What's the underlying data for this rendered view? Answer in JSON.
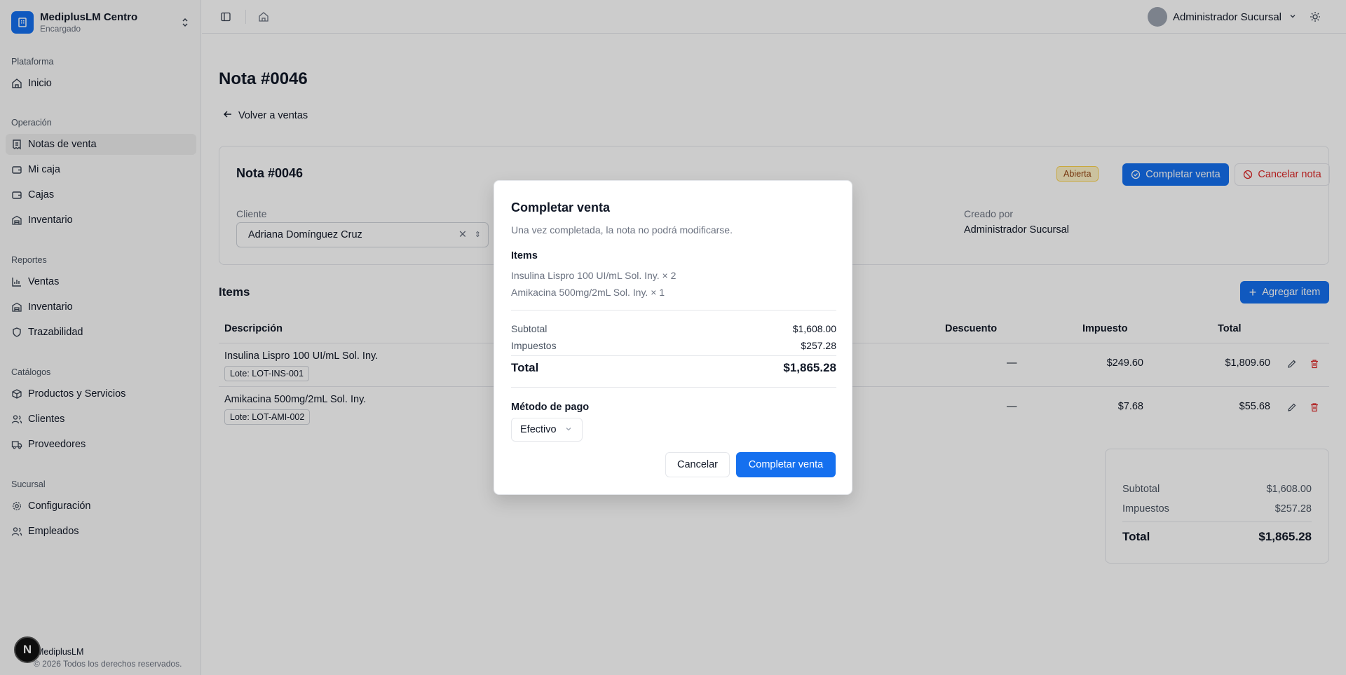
{
  "colors": {
    "primary": "#1570ef",
    "danger": "#dc2626",
    "badge_open_bg": "#fef3c7"
  },
  "sidebar": {
    "brand_name": "MediplusLM Centro",
    "brand_role": "Encargado",
    "sections": [
      {
        "title": "Plataforma",
        "items": [
          {
            "label": "Inicio",
            "icon": "home-icon"
          }
        ]
      },
      {
        "title": "Operación",
        "items": [
          {
            "label": "Notas de venta",
            "icon": "receipt-icon",
            "active": true
          },
          {
            "label": "Mi caja",
            "icon": "wallet-icon"
          },
          {
            "label": "Cajas",
            "icon": "wallet-icon"
          },
          {
            "label": "Inventario",
            "icon": "warehouse-icon"
          }
        ]
      },
      {
        "title": "Reportes",
        "items": [
          {
            "label": "Ventas",
            "icon": "bar-chart-icon"
          },
          {
            "label": "Inventario",
            "icon": "warehouse-icon"
          },
          {
            "label": "Trazabilidad",
            "icon": "shield-icon"
          }
        ]
      },
      {
        "title": "Catálogos",
        "items": [
          {
            "label": "Productos y Servicios",
            "icon": "package-icon"
          },
          {
            "label": "Clientes",
            "icon": "users-icon"
          },
          {
            "label": "Proveedores",
            "icon": "truck-icon"
          }
        ]
      },
      {
        "title": "Sucursal",
        "items": [
          {
            "label": "Configuración",
            "icon": "gear-icon"
          },
          {
            "label": "Empleados",
            "icon": "users-icon"
          }
        ]
      }
    ],
    "footer_badge": "N",
    "footer_name": "MediplusLM",
    "footer_copy": "© 2026 Todos los derechos reservados."
  },
  "topbar": {
    "user_name": "Administrador Sucursal"
  },
  "page": {
    "title": "Nota #0046",
    "back_label": "Volver a ventas",
    "card": {
      "title": "Nota #0046",
      "status": "Abierta",
      "complete_label": "Completar venta",
      "cancel_label": "Cancelar nota",
      "client_label": "Cliente",
      "client_value": "Adriana Domínguez Cruz",
      "creator_label": "Creado por",
      "creator_value": "Administrador Sucursal"
    },
    "items_title": "Items",
    "add_item_label": "Agregar item",
    "columns": {
      "description": "Descripción",
      "discount": "Descuento",
      "tax": "Impuesto",
      "total": "Total"
    },
    "rows": [
      {
        "description": "Insulina Lispro 100 UI/mL Sol. Iny.",
        "lot": "Lote: LOT-INS-001",
        "discount": "—",
        "tax": "$249.60",
        "total": "$1,809.60"
      },
      {
        "description": "Amikacina 500mg/2mL Sol. Iny.",
        "lot": "Lote: LOT-AMI-002",
        "discount": "—",
        "tax": "$7.68",
        "total": "$55.68"
      }
    ],
    "summary": {
      "subtotal_label": "Subtotal",
      "subtotal": "$1,608.00",
      "tax_label": "Impuestos",
      "tax": "$257.28",
      "total_label": "Total",
      "total": "$1,865.28"
    }
  },
  "modal": {
    "title": "Completar venta",
    "description": "Una vez completada, la nota no podrá modificarse.",
    "items_title": "Items",
    "items": [
      "Insulina Lispro 100 UI/mL Sol. Iny. × 2",
      "Amikacina 500mg/2mL Sol. Iny. × 1"
    ],
    "subtotal_label": "Subtotal",
    "subtotal": "$1,608.00",
    "tax_label": "Impuestos",
    "tax": "$257.28",
    "total_label": "Total",
    "total": "$1,865.28",
    "payment_label": "Método de pago",
    "payment_value": "Efectivo",
    "cancel_label": "Cancelar",
    "confirm_label": "Completar venta"
  }
}
